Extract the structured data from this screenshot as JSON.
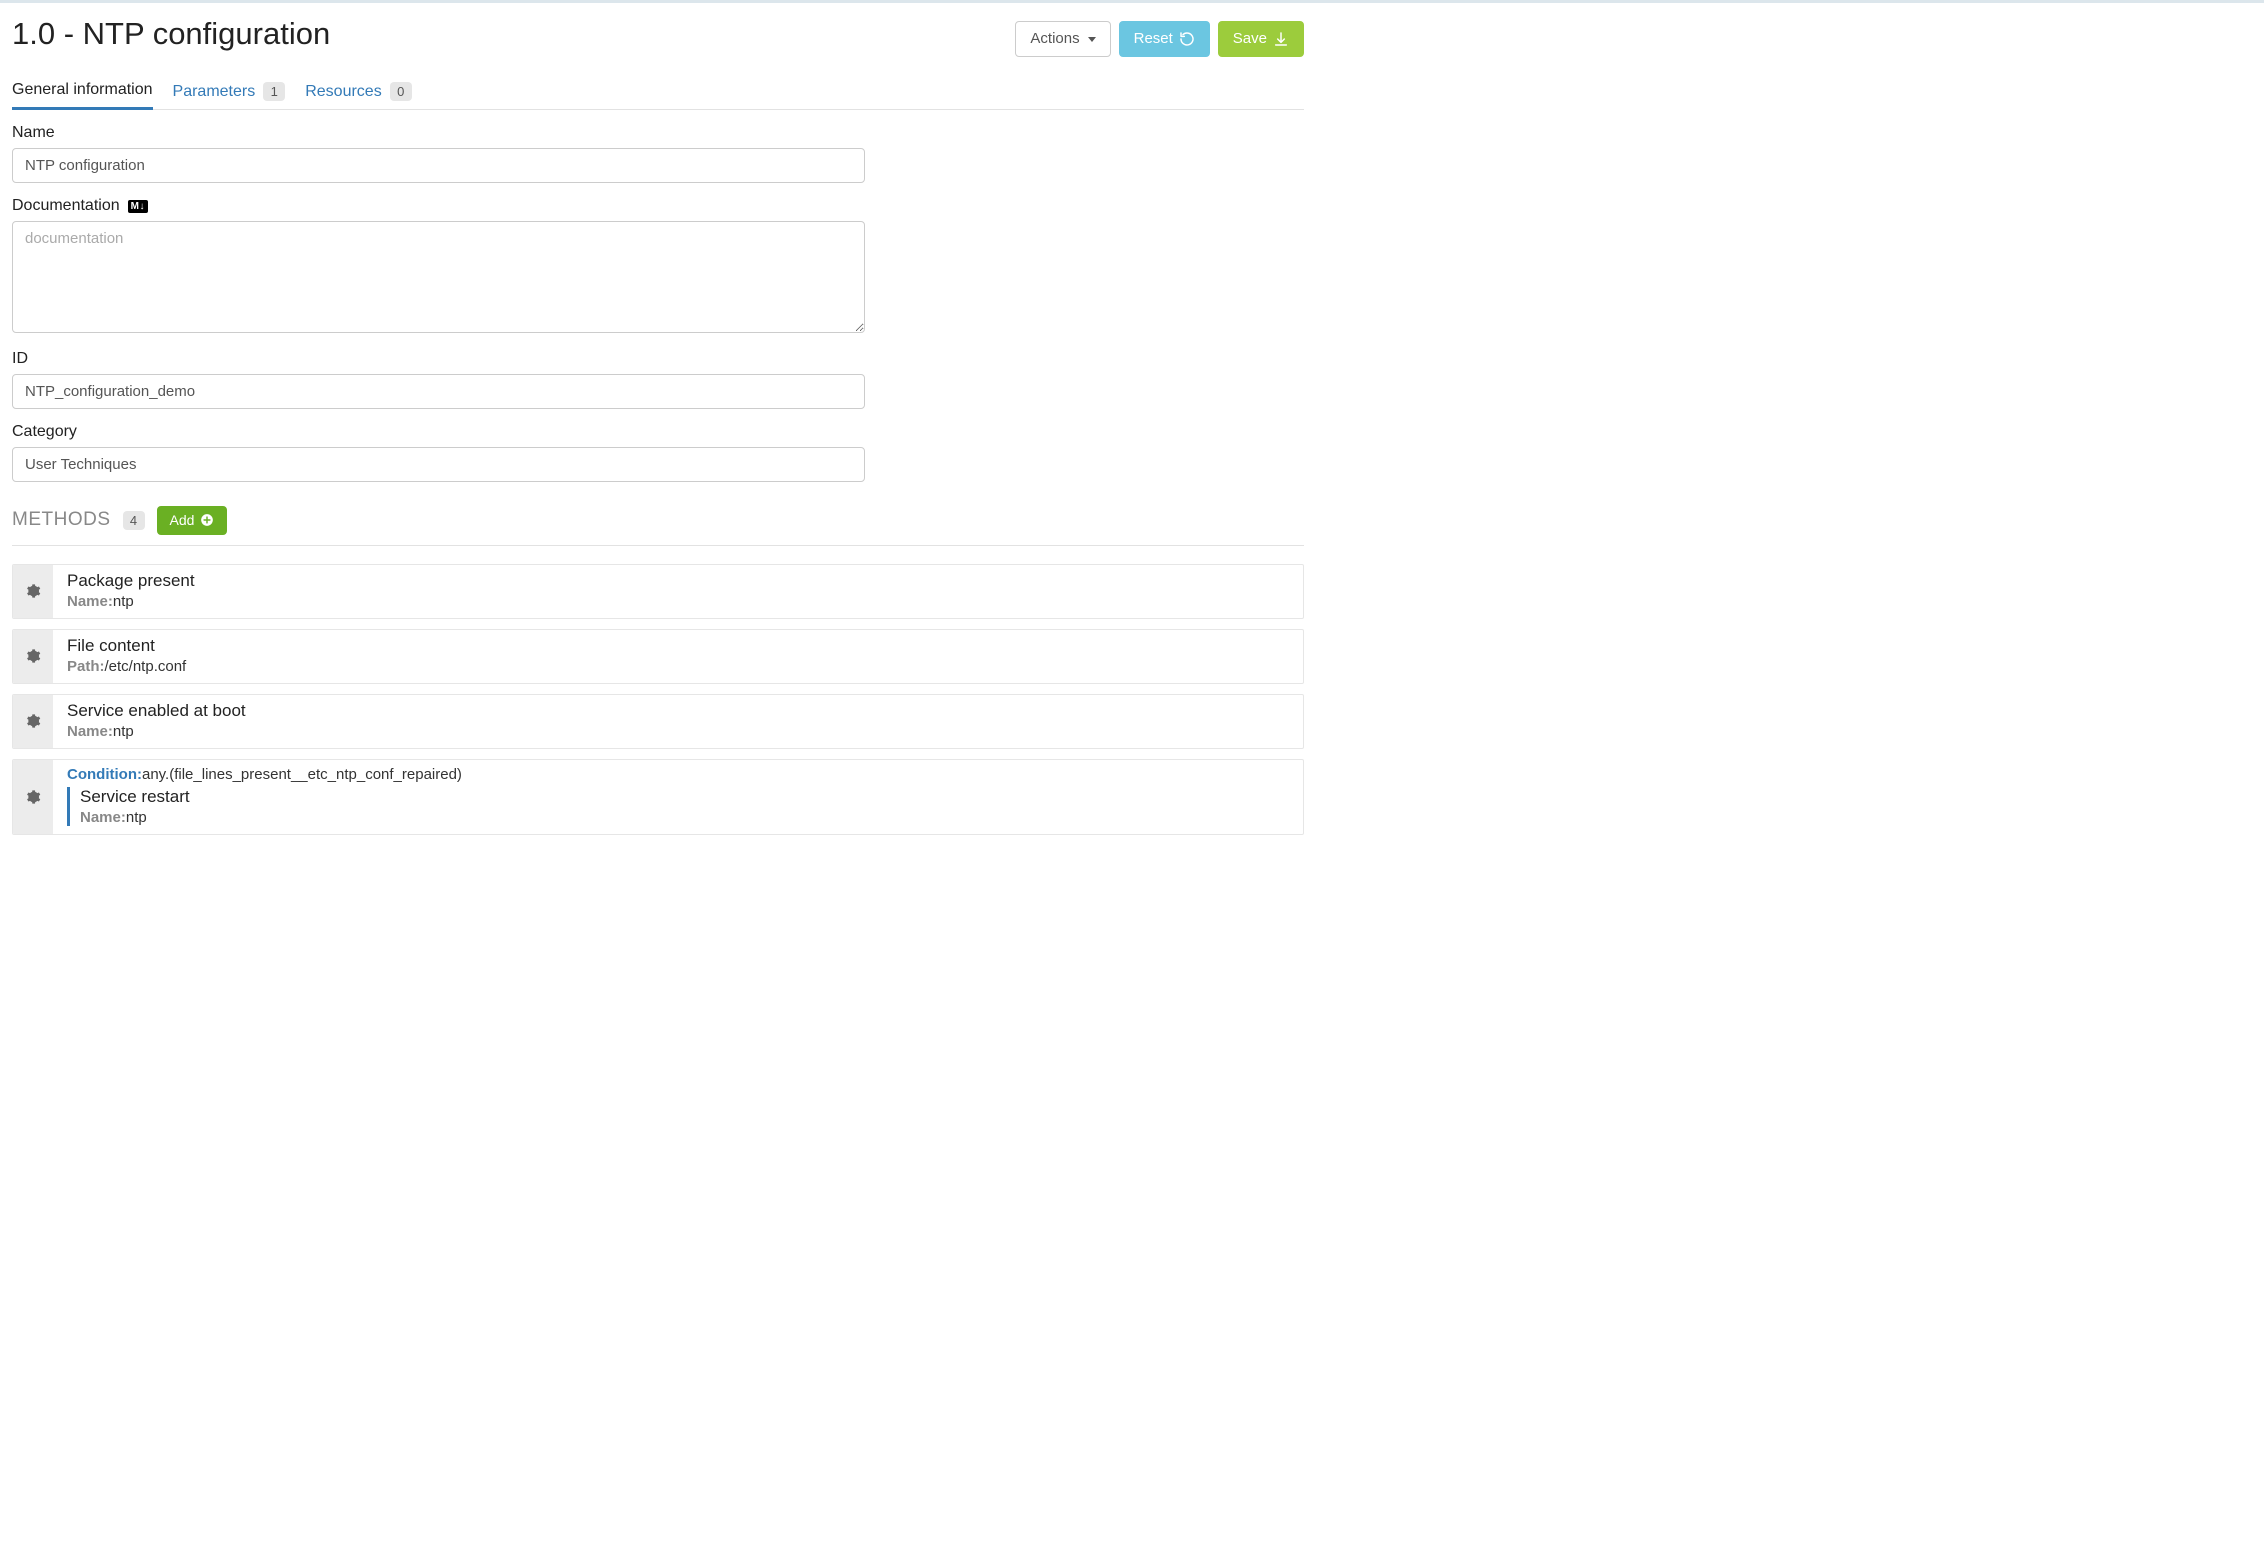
{
  "header": {
    "title": "1.0 - NTP configuration",
    "actions_label": "Actions",
    "reset_label": "Reset",
    "save_label": "Save"
  },
  "tabs": {
    "general": {
      "label": "General information"
    },
    "parameters": {
      "label": "Parameters",
      "count": "1"
    },
    "resources": {
      "label": "Resources",
      "count": "0"
    }
  },
  "form": {
    "name_label": "Name",
    "name_value": "NTP configuration",
    "doc_label": "Documentation",
    "doc_placeholder": "documentation",
    "doc_value": "",
    "id_label": "ID",
    "id_value": "NTP_configuration_demo",
    "category_label": "Category",
    "category_value": "User Techniques",
    "md_badge": "M↓"
  },
  "methods": {
    "section_title": "METHODS",
    "count": "4",
    "add_label": "Add",
    "items": [
      {
        "title": "Package present",
        "param_label": "Name:",
        "param_value": "ntp"
      },
      {
        "title": "File content",
        "param_label": "Path:",
        "param_value": "/etc/ntp.conf"
      },
      {
        "title": "Service enabled at boot",
        "param_label": "Name:",
        "param_value": "ntp"
      },
      {
        "condition_label": "Condition:",
        "condition_value": "any.(file_lines_present__etc_ntp_conf_repaired)",
        "title": "Service restart",
        "param_label": "Name:",
        "param_value": "ntp"
      }
    ]
  }
}
